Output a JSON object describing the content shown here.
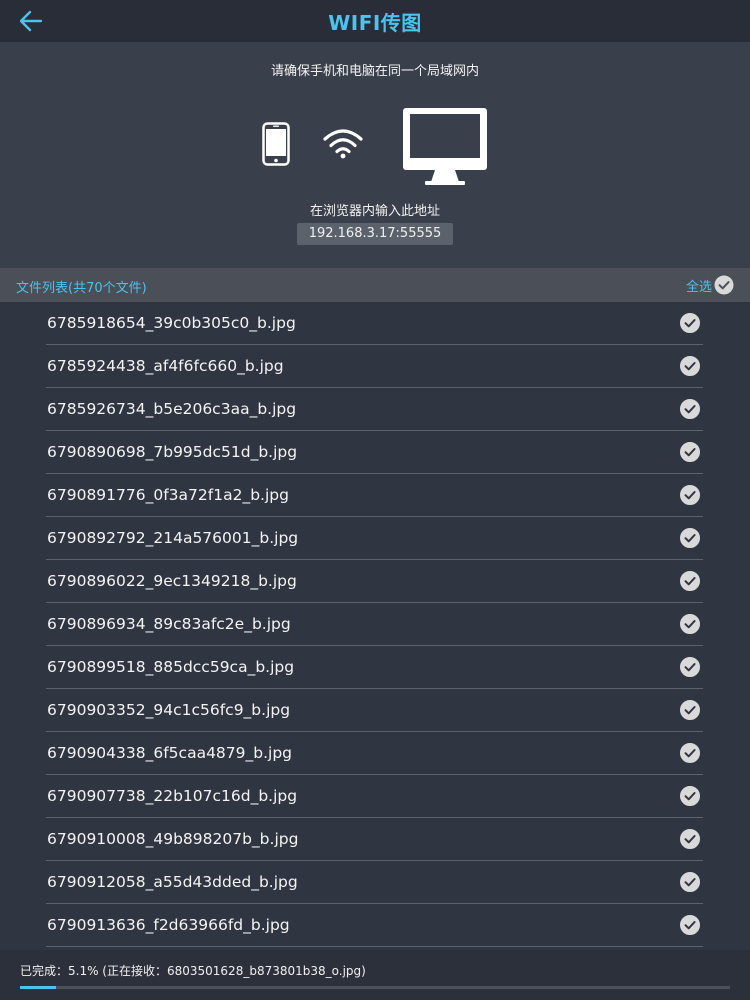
{
  "header": {
    "title": "WIFI传图",
    "back_icon": "arrow-left-icon"
  },
  "info": {
    "notice": "请确保手机和电脑在同一个局域网内",
    "instruction": "在浏览器内输入此地址",
    "address": "192.168.3.17:55555",
    "icons": [
      "phone-icon",
      "wifi-icon",
      "monitor-icon"
    ]
  },
  "list": {
    "title": "文件列表(共70个文件)",
    "select_all_label": "全选",
    "files": [
      {
        "name": "6785918654_39c0b305c0_b.jpg",
        "selected": true
      },
      {
        "name": "6785924438_af4f6fc660_b.jpg",
        "selected": true
      },
      {
        "name": "6785926734_b5e206c3aa_b.jpg",
        "selected": true
      },
      {
        "name": "6790890698_7b995dc51d_b.jpg",
        "selected": true
      },
      {
        "name": "6790891776_0f3a72f1a2_b.jpg",
        "selected": true
      },
      {
        "name": "6790892792_214a576001_b.jpg",
        "selected": true
      },
      {
        "name": "6790896022_9ec1349218_b.jpg",
        "selected": true
      },
      {
        "name": "6790896934_89c83afc2e_b.jpg",
        "selected": true
      },
      {
        "name": "6790899518_885dcc59ca_b.jpg",
        "selected": true
      },
      {
        "name": "6790903352_94c1c56fc9_b.jpg",
        "selected": true
      },
      {
        "name": "6790904338_6f5caa4879_b.jpg",
        "selected": true
      },
      {
        "name": "6790907738_22b107c16d_b.jpg",
        "selected": true
      },
      {
        "name": "6790910008_49b898207b_b.jpg",
        "selected": true
      },
      {
        "name": "6790912058_a55d43dded_b.jpg",
        "selected": true
      },
      {
        "name": "6790913636_f2d63966fd_b.jpg",
        "selected": true
      }
    ]
  },
  "status": {
    "text": "已完成：5.1%  (正在接收：6803501628_b873801b38_o.jpg)",
    "progress_percent": 5.1
  },
  "colors": {
    "accent": "#4cc2ef",
    "background": "#2f3541",
    "header_bg": "#282d37"
  }
}
